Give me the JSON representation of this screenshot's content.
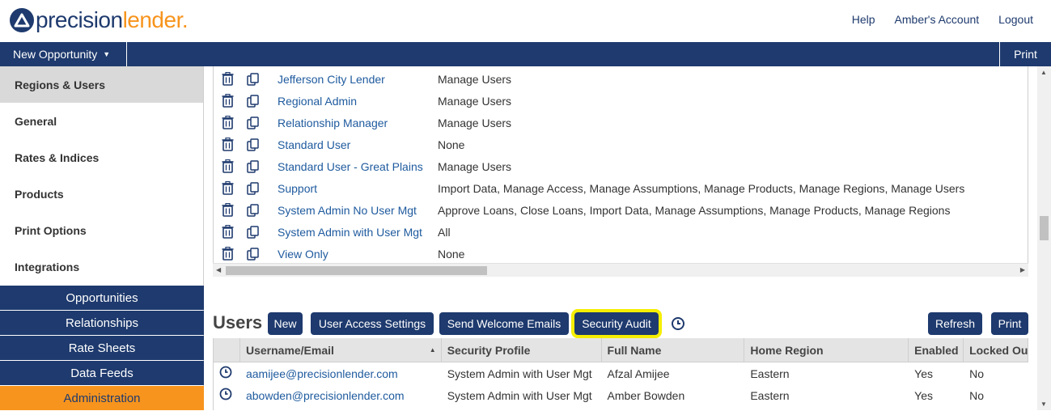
{
  "brand": {
    "part1": "precision",
    "part2": "lender",
    "dot": "."
  },
  "toplinks": {
    "help": "Help",
    "account": "Amber's Account",
    "logout": "Logout"
  },
  "navbar": {
    "new_opportunity": "New Opportunity",
    "print": "Print"
  },
  "sidebar": {
    "items": [
      "Regions & Users",
      "General",
      "Rates & Indices",
      "Products",
      "Print Options",
      "Integrations"
    ],
    "active": "Regions & Users",
    "modules": [
      "Opportunities",
      "Relationships",
      "Rate Sheets",
      "Data Feeds",
      "Administration"
    ]
  },
  "roles": [
    {
      "name": "Jefferson City Lender",
      "perms": "Manage Users"
    },
    {
      "name": "Regional Admin",
      "perms": "Manage Users"
    },
    {
      "name": "Relationship Manager",
      "perms": "Manage Users"
    },
    {
      "name": "Standard User",
      "perms": "None"
    },
    {
      "name": "Standard User - Great Plains",
      "perms": "Manage Users"
    },
    {
      "name": "Support",
      "perms": "Import Data, Manage Access, Manage Assumptions, Manage Products, Manage Regions, Manage Users"
    },
    {
      "name": "System Admin No User Mgt",
      "perms": "Approve Loans, Close Loans, Import Data, Manage Assumptions, Manage Products, Manage Regions"
    },
    {
      "name": "System Admin with User Mgt",
      "perms": "All"
    },
    {
      "name": "View Only",
      "perms": "None"
    }
  ],
  "users": {
    "title": "Users",
    "buttons": {
      "new": "New",
      "access": "User Access Settings",
      "welcome": "Send Welcome Emails",
      "audit": "Security Audit",
      "refresh": "Refresh",
      "print": "Print"
    },
    "columns": [
      "Username/Email",
      "Security Profile",
      "Full Name",
      "Home Region",
      "Enabled",
      "Locked Out"
    ],
    "rows": [
      {
        "email": "aamijee@precisionlender.com",
        "profile": "System Admin with User Mgt",
        "name": "Afzal Amijee",
        "region": "Eastern",
        "enabled": "Yes",
        "locked": "No"
      },
      {
        "email": "abowden@precisionlender.com",
        "profile": "System Admin with User Mgt",
        "name": "Amber Bowden",
        "region": "Eastern",
        "enabled": "Yes",
        "locked": "No"
      }
    ]
  },
  "colors": {
    "navy": "#1e3a6e",
    "orange": "#f7941d",
    "link": "#1e5a9e",
    "highlight": "#f5ee00"
  }
}
